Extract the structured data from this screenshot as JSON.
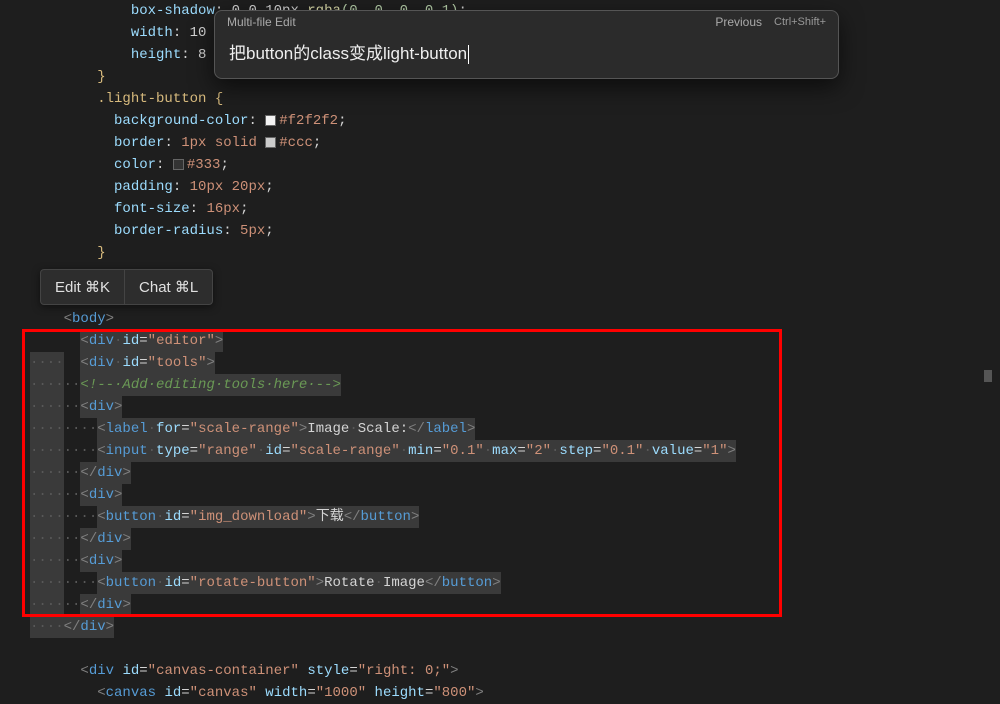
{
  "dialog": {
    "title": "Multi-file Edit",
    "previous": "Previous",
    "shortcut": "Ctrl+Shift+",
    "input_value": "把button的class变成light-button"
  },
  "action_menu": {
    "edit": "Edit ⌘K",
    "chat": "Chat ⌘L"
  },
  "code": {
    "css": {
      "l1_prop": "box-shadow",
      "l1_val_prefix": ": 0 0 10px ",
      "l1_func": "rgba",
      "l1_args": "(0, 0, 0, 0.1)",
      "l1_end": ";",
      "l2_prop": "width",
      "l2_val": ": 10",
      "l3_prop": "height",
      "l3_val": ": 8",
      "close1": "}",
      "selector": ".light-button {",
      "bg_prop": "background-color",
      "bg_val": "#f2f2f2",
      "border_prop": "border",
      "border_val1": "1px solid ",
      "border_val2": "#ccc",
      "color_prop": "color",
      "color_val": "#333",
      "padding_prop": "padding",
      "padding_val": "10px 20px",
      "fontsize_prop": "font-size",
      "fontsize_val": "16px",
      "radius_prop": "border-radius",
      "radius_val": "5px",
      "close2": "}"
    },
    "html": {
      "head_close": "<",
      "body_open": "body",
      "div_editor_open": "<div id=\"editor\">",
      "div_tools_open": "<div id=\"tools\">",
      "comment_tools": "<!-- Add editing tools here -->",
      "div_open": "<div>",
      "label_scale": "Image Scale:",
      "label_for": "scale-range",
      "input_type": "range",
      "input_id": "scale-range",
      "input_min": "0.1",
      "input_max": "2",
      "input_step": "0.1",
      "input_value": "1",
      "div_close": "</div>",
      "btn_download_id": "img_download",
      "btn_download_text": "下载",
      "btn_rotate_id": "rotate-button",
      "btn_rotate_text": "Rotate Image",
      "canvas_container": "<div id=\"canvas-container\" style=\"right: 0;\">",
      "canvas": "<canvas id=\"canvas\" width=\"1000\" height=\"800\">"
    }
  }
}
